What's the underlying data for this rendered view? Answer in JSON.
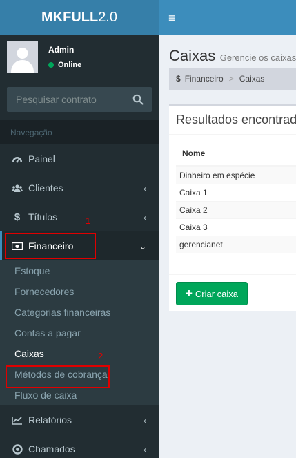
{
  "app": {
    "logo_bold": "MKFULL",
    "logo_light": "2.0"
  },
  "user": {
    "name": "Admin",
    "status": "Online"
  },
  "search": {
    "placeholder": "Pesquisar contrato"
  },
  "nav_header": "Navegação",
  "menu": {
    "painel": "Painel",
    "clientes": "Clientes",
    "titulos": "Títulos",
    "financeiro": "Financeiro",
    "relatorios": "Relatórios",
    "chamados": "Chamados"
  },
  "submenu": [
    "Estoque",
    "Fornecedores",
    "Categorias financeiras",
    "Contas a pagar",
    "Caixas",
    "Métodos de cobrança",
    "Fluxo de caixa"
  ],
  "annotations": {
    "one": "1",
    "two": "2"
  },
  "page": {
    "title": "Caixas",
    "subtitle": "Gerencie os caixas d",
    "breadcrumb": [
      "Financeiro",
      "Caixas"
    ]
  },
  "results": {
    "title": "Resultados encontrado",
    "column": "Nome",
    "rows": [
      "Dinheiro em espécie",
      "Caixa 1",
      "Caixa 2",
      "Caixa 3",
      "gerencianet"
    ],
    "create_button": "Criar caixa"
  },
  "colors": {
    "sidebar": "#222d32",
    "logo_bg": "#367fa9",
    "header": "#3c8dbc",
    "success": "#00a65a",
    "annotation": "#e00000"
  }
}
